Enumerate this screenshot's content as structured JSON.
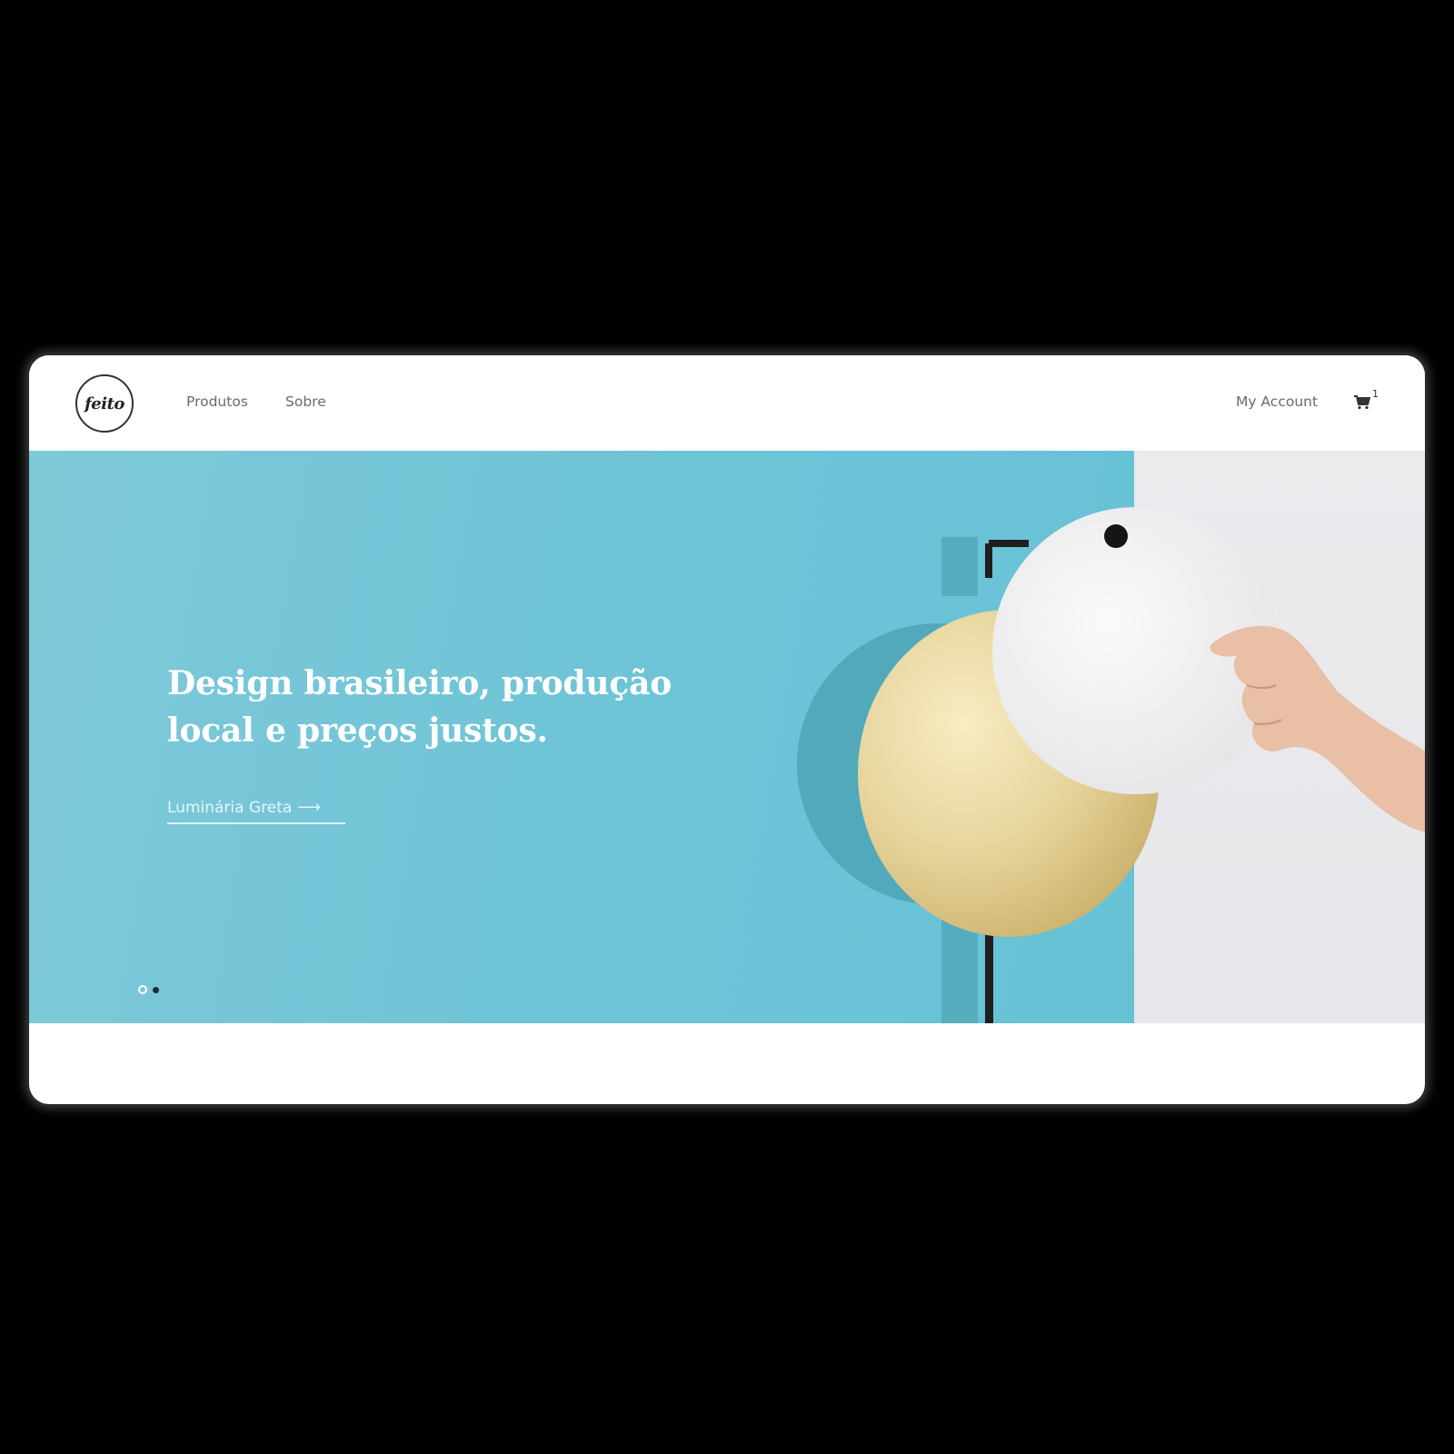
{
  "header": {
    "logo_text": "feito",
    "nav": [
      {
        "label": "Produtos"
      },
      {
        "label": "Sobre"
      }
    ],
    "account_label": "My Account",
    "cart_icon": "cart-icon",
    "cart_count": "1"
  },
  "hero": {
    "headline": "Design brasileiro, produção local e preços justos.",
    "cta_label": "Luminária Greta",
    "cta_arrow": "⟶",
    "slides_total": 2,
    "active_slide": 1
  },
  "colors": {
    "hero_bg": "#6fc4d7",
    "text_white": "#ffffff",
    "nav_text": "#6b6b6b"
  }
}
